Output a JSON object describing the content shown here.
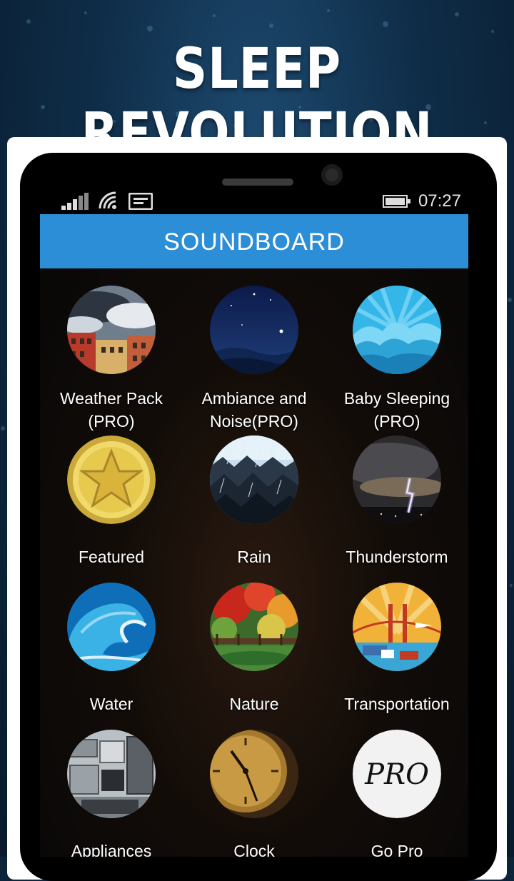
{
  "banner": {
    "title": "SLEEP REVOLUTION"
  },
  "status": {
    "time": "07:27",
    "signal_icon": "signal-bars-icon",
    "wifi_icon": "wifi-icon",
    "message_icon": "message-icon",
    "battery_icon": "battery-icon"
  },
  "header": {
    "title": "SOUNDBOARD"
  },
  "tiles": [
    {
      "label": "Weather Pack\n(PRO)",
      "icon": "city-weather-icon"
    },
    {
      "label": "Ambiance and\nNoise(PRO)",
      "icon": "night-sky-icon"
    },
    {
      "label": "Baby Sleeping\n(PRO)",
      "icon": "clouds-icon"
    },
    {
      "label": "Featured",
      "icon": "star-coin-icon"
    },
    {
      "label": "Rain",
      "icon": "rain-mountains-icon"
    },
    {
      "label": "Thunderstorm",
      "icon": "lightning-icon"
    },
    {
      "label": "Water",
      "icon": "wave-icon"
    },
    {
      "label": "Nature",
      "icon": "garden-icon"
    },
    {
      "label": "Transportation",
      "icon": "bridge-vehicles-icon"
    },
    {
      "label": "Appliances",
      "icon": "kitchen-appliances-icon"
    },
    {
      "label": "Clock",
      "icon": "clock-icon"
    },
    {
      "label": "Go Pro",
      "icon": "pro-badge-icon",
      "badge_text": "PRO"
    }
  ]
}
